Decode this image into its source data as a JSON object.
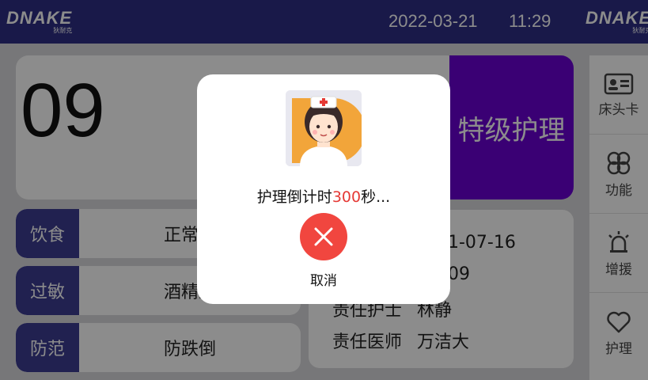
{
  "header": {
    "logo_text": "DNAKE",
    "logo_sub": "狄耐克",
    "date": "2022-03-21",
    "time": "11:29"
  },
  "bed": {
    "number": "09",
    "care_level": "特级护理"
  },
  "info_rows": [
    {
      "label": "饮食",
      "value": "正常饮"
    },
    {
      "label": "过敏",
      "value": "酒精过"
    },
    {
      "label": "防范",
      "value": "防跌倒"
    }
  ],
  "staff": {
    "admission_date_partial": "1-07-16",
    "line2_partial": "09",
    "nurse_label": "责任护士",
    "nurse_name": "林静",
    "doctor_label": "责任医师",
    "doctor_name": "万洁大"
  },
  "sidebar": {
    "items": [
      {
        "label": "床头卡",
        "icon": "id-card-icon"
      },
      {
        "label": "功能",
        "icon": "clover-icon"
      },
      {
        "label": "增援",
        "icon": "alarm-light-icon"
      },
      {
        "label": "护理",
        "icon": "heart-icon"
      }
    ]
  },
  "dialog": {
    "countdown_prefix": "护理倒计时",
    "countdown_value": "300",
    "countdown_suffix": "秒...",
    "cancel_label": "取消",
    "accent_color": "#f1463f"
  }
}
